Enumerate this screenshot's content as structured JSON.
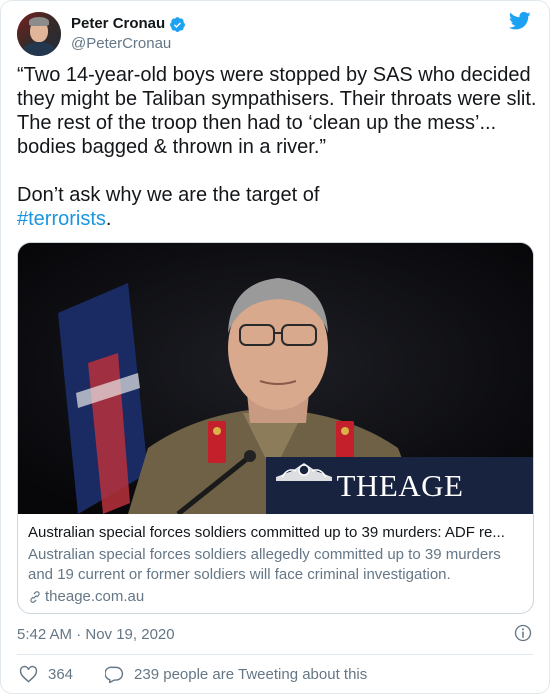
{
  "author": {
    "name": "Peter Cronau",
    "handle": "@PeterCronau"
  },
  "tweet": {
    "text_line1": "“Two 14-year-old boys were stopped by SAS who decided they might be Taliban sympathisers. Their throats were slit. The rest of the troop then had to ‘clean up the mess’... bodies bagged & thrown in a river.”",
    "text_line2": "Don’t ask why we are the target of",
    "hashtag": "#terrorists",
    "hashtag_suffix": "."
  },
  "card": {
    "brand_left": "THE",
    "brand_right": "AGE",
    "title": "Australian special forces soldiers committed up to 39 murders: ADF re...",
    "description": "Australian special forces soldiers allegedly committed up to 39 murders and 19 current or former soldiers will face criminal investigation.",
    "domain": "theage.com.au"
  },
  "timestamp": "5:42 AM · Nov 19, 2020",
  "actions": {
    "likes": "364",
    "replies_text": "239 people are Tweeting about this"
  },
  "colors": {
    "link": "#1b95e0",
    "twitter_blue": "#1da1f2",
    "muted": "#657786",
    "like_red": "#e0245e"
  }
}
